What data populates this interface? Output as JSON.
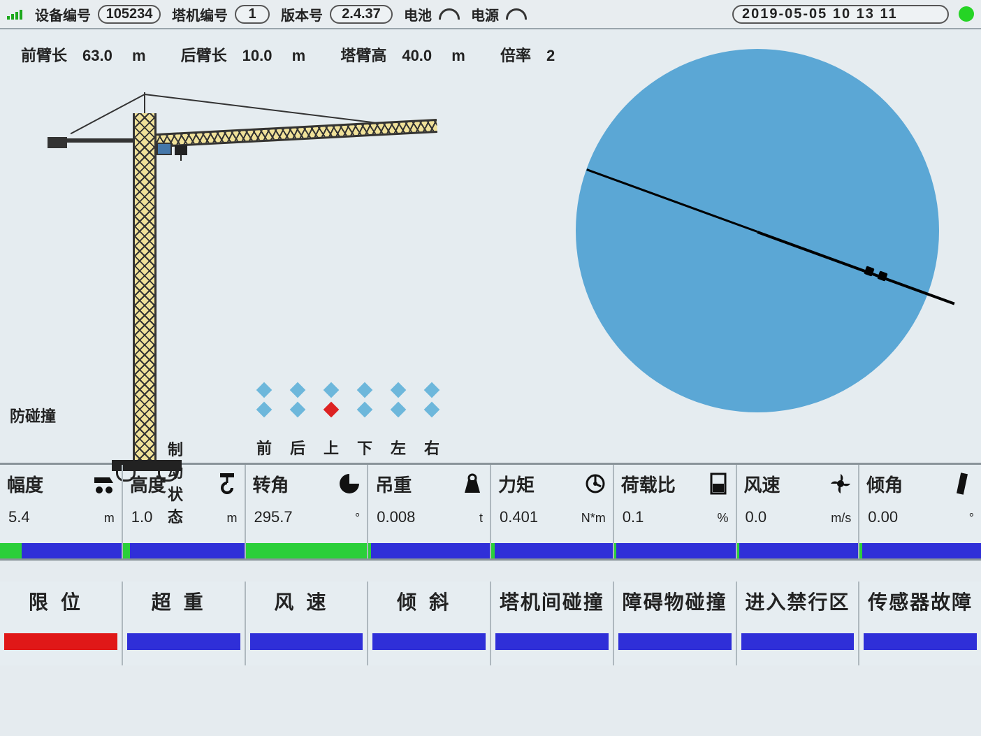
{
  "header": {
    "device_label": "设备编号",
    "device_id": "105234",
    "crane_label": "塔机编号",
    "crane_no": "1",
    "version_label": "版本号",
    "version": "2.4.37",
    "battery_label": "电池",
    "power_label": "电源",
    "datetime": "2019-05-05 10 13 11"
  },
  "arm": {
    "front_label": "前臂长",
    "front_value": "63.0",
    "back_label": "后臂长",
    "back_value": "10.0",
    "height_label": "塔臂高",
    "height_value": "40.0",
    "unit": "m",
    "ratio_label": "倍率",
    "ratio_value": "2"
  },
  "anti_collision_label": "防碰撞",
  "brake": {
    "title": "制动状态",
    "labels": [
      "前",
      "后",
      "上",
      "下",
      "左",
      "右"
    ],
    "row1": [
      "off",
      "off",
      "off",
      "off",
      "off",
      "off"
    ],
    "row2": [
      "off",
      "off",
      "on",
      "off",
      "off",
      "off"
    ]
  },
  "radar": {
    "angle_deg": 20
  },
  "metrics": [
    {
      "name": "幅度",
      "icon": "trolley-icon",
      "value": "5.4",
      "unit": "m",
      "fill": 0.18
    },
    {
      "name": "高度",
      "icon": "hook-icon",
      "value": "1.0",
      "unit": "m",
      "fill": 0.06
    },
    {
      "name": "转角",
      "icon": "angle-icon",
      "value": "295.7",
      "unit": "°",
      "fill": 1.0
    },
    {
      "name": "吊重",
      "icon": "weight-icon",
      "value": "0.008",
      "unit": "t",
      "fill": 0.02
    },
    {
      "name": "力矩",
      "icon": "moment-icon",
      "value": "0.401",
      "unit": "N*m",
      "fill": 0.03
    },
    {
      "name": "荷载比",
      "icon": "load-icon",
      "value": "0.1",
      "unit": "%",
      "fill": 0.02
    },
    {
      "name": "风速",
      "icon": "fan-icon",
      "value": "0.0",
      "unit": "m/s",
      "fill": 0.02
    },
    {
      "name": "倾角",
      "icon": "tilt-icon",
      "value": "0.00",
      "unit": "°",
      "fill": 0.02
    }
  ],
  "alarms": [
    {
      "label": "限位",
      "spread": true,
      "color": "red"
    },
    {
      "label": "超重",
      "spread": true,
      "color": "blue"
    },
    {
      "label": "风速",
      "spread": true,
      "color": "blue"
    },
    {
      "label": "倾斜",
      "spread": true,
      "color": "blue"
    },
    {
      "label": "塔机间碰撞",
      "spread": false,
      "color": "blue"
    },
    {
      "label": "障碍物碰撞",
      "spread": false,
      "color": "blue"
    },
    {
      "label": "进入禁行区",
      "spread": false,
      "color": "blue"
    },
    {
      "label": "传感器故障",
      "spread": false,
      "color": "blue"
    }
  ]
}
